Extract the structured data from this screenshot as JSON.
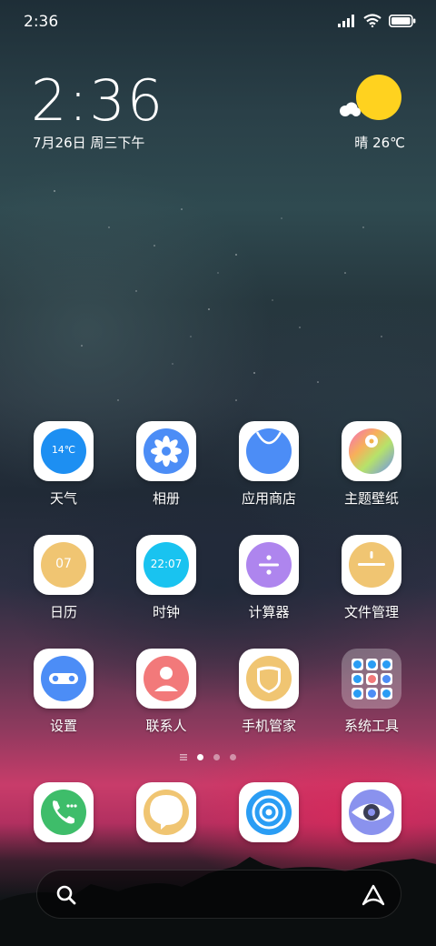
{
  "status_bar": {
    "time": "2:36"
  },
  "clock": {
    "time": "2:36",
    "date": "7月26日 周三下午"
  },
  "weather": {
    "text": "晴 26℃",
    "sun_color": "#ffd21f"
  },
  "apps": {
    "weather": {
      "label": "天气",
      "temp": "14℃",
      "color": "#1d8ff2"
    },
    "gallery": {
      "label": "相册",
      "color": "#4c8df6"
    },
    "app_store": {
      "label": "应用商店",
      "color": "#4c8df6"
    },
    "themes": {
      "label": "主题壁纸"
    },
    "calendar": {
      "label": "日历",
      "day": "07",
      "color": "#f0c572"
    },
    "clock": {
      "label": "时钟",
      "time": "22:07",
      "color": "#19c3f0"
    },
    "calculator": {
      "label": "计算器",
      "color": "#ae85ee"
    },
    "file_manager": {
      "label": "文件管理",
      "color": "#f0c572"
    },
    "settings": {
      "label": "设置",
      "color": "#4c8df6"
    },
    "contacts": {
      "label": "联系人",
      "color": "#f2797a"
    },
    "security": {
      "label": "手机管家",
      "color": "#f0c572"
    },
    "system_tools": {
      "label": "系统工具"
    }
  },
  "dock": {
    "phone": {
      "icon": "phone-icon",
      "color": "#3ebd6a"
    },
    "messages": {
      "icon": "message-icon",
      "color": "#f0c572"
    },
    "browser": {
      "icon": "browser-icon",
      "color": "#2a9df4"
    },
    "camera": {
      "icon": "camera-icon",
      "color": "#8a92ee"
    }
  },
  "search": {
    "icon": "search-icon",
    "assistant_icon": "assistant-icon"
  }
}
